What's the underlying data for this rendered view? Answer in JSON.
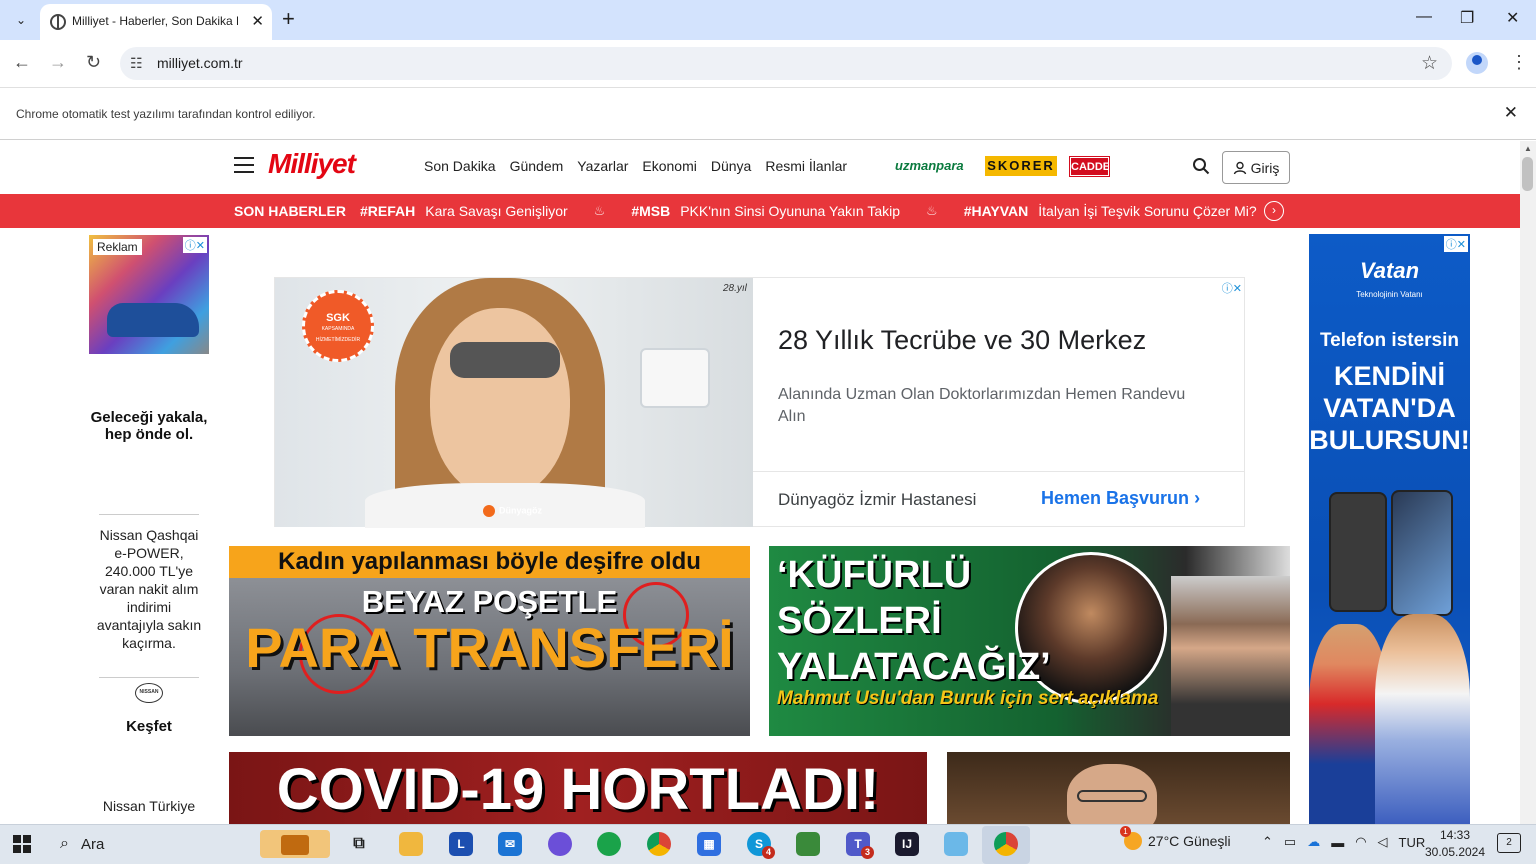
{
  "browser": {
    "tab_title": "Milliyet - Haberler, Son Dakika Haberler",
    "url": "milliyet.com.tr",
    "infobar_text": "Chrome otomatik test yazılımı tarafından kontrol ediliyor."
  },
  "site": {
    "logo": "Milliyet",
    "nav": [
      "Son Dakika",
      "Gündem",
      "Yazarlar",
      "Ekonomi",
      "Dünya",
      "Resmi İlanlar"
    ],
    "partners": {
      "uzmanpara": "uzmanpara",
      "skorer": "SKORER",
      "cadde": "CADDE"
    },
    "login_label": "Giriş",
    "ticker": {
      "label": "SON HABERLER",
      "items": [
        {
          "tag": "#REFAH",
          "text": "Kara Savaşı Genişliyor"
        },
        {
          "tag": "#MSB",
          "text": "PKK'nın Sinsi Oyununa Yakın Takip"
        },
        {
          "tag": "#HAYVAN",
          "text": "İtalyan İşi Teşvik Sorunu Çözer Mi?"
        }
      ]
    }
  },
  "left_ad": {
    "reklam": "Reklam",
    "slogan": "Geleceği yakala, hep önde ol.",
    "offer": "Nissan Qashqai e-POWER, 240.000 TL'ye varan nakit alım indirimi avantajıyla sakın kaçırma.",
    "logo_text": "NISSAN",
    "cta": "Keşfet",
    "brand": "Nissan Türkiye"
  },
  "center_ad": {
    "sgk_title": "SGK",
    "sgk_sub": "KAPSAMINDA HİZMETİMİZDEDİR",
    "years": "28.yıl",
    "photo_brand": "Dünyagöz",
    "headline": "28 Yıllık Tecrübe ve 30 Merkez",
    "description": "Alanında Uzman Olan Doktorlarımızdan Hemen Randevu Alın",
    "advertiser": "Dünyagöz İzmir Hastanesi",
    "cta": "Hemen Başvurun"
  },
  "cards": [
    {
      "line1": "Kadın yapılanması böyle deşifre oldu",
      "line2": "BEYAZ POŞETLE",
      "line3": "PARA TRANSFERİ"
    },
    {
      "quote": "‘KÜFÜRLÜ SÖZLERİ YALATACAĞIZ’",
      "sub": "Mahmut Uslu'dan Buruk için sert açıklama"
    },
    {
      "title": "COVID-19 HORTLADI!"
    },
    {}
  ],
  "right_ad": {
    "brand": "Vatan",
    "brand_sub": "Teknolojinin Vatanı",
    "line1": "Telefon istersin",
    "line2": "KENDİNİ VATAN'DA BULURSUN!"
  },
  "taskbar": {
    "search_placeholder": "Ara",
    "weather": "27°C Güneşli",
    "weather_badge": "1",
    "lang": "TUR",
    "time": "14:33",
    "date": "30.05.2024",
    "notif_count": "2",
    "skype_badge": "4",
    "teams_badge": "3"
  }
}
